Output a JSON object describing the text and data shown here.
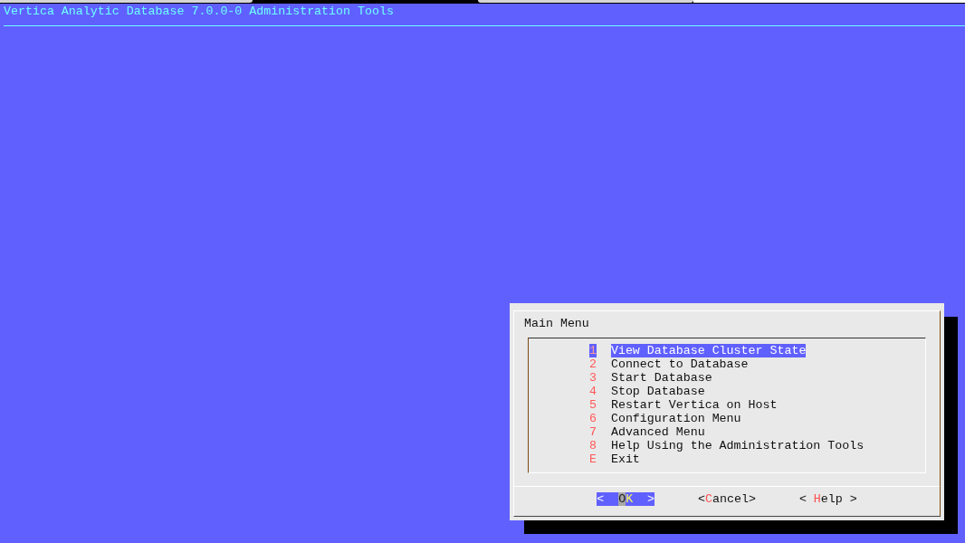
{
  "header": {
    "title": "Vertica Analytic Database 7.0.0-0 Administration Tools"
  },
  "dialog": {
    "title": "Main Menu",
    "items": [
      {
        "key": "1",
        "label": "View Database Cluster State",
        "selected": true
      },
      {
        "key": "2",
        "label": "Connect to Database",
        "selected": false
      },
      {
        "key": "3",
        "label": "Start Database",
        "selected": false
      },
      {
        "key": "4",
        "label": "Stop Database",
        "selected": false
      },
      {
        "key": "5",
        "label": "Restart Vertica on Host",
        "selected": false
      },
      {
        "key": "6",
        "label": "Configuration Menu",
        "selected": false
      },
      {
        "key": "7",
        "label": "Advanced Menu",
        "selected": false
      },
      {
        "key": "8",
        "label": "Help Using the Administration Tools",
        "selected": false
      },
      {
        "key": "E",
        "label": "Exit",
        "selected": false
      }
    ],
    "buttons": [
      {
        "open": "<",
        "close": ">",
        "selected": true,
        "parts": [
          {
            "text": "O",
            "kind": "cursor"
          },
          {
            "text": "K",
            "kind": "hotkey"
          }
        ]
      },
      {
        "open": "<",
        "close": ">",
        "selected": false,
        "parts": [
          {
            "text": "C",
            "kind": "hotkey"
          },
          {
            "text": "ancel",
            "kind": "plain"
          }
        ]
      },
      {
        "open": "<",
        "close": ">",
        "selected": false,
        "parts": [
          {
            "text": "H",
            "kind": "hotkey"
          },
          {
            "text": "elp",
            "kind": "plain"
          }
        ]
      }
    ]
  }
}
